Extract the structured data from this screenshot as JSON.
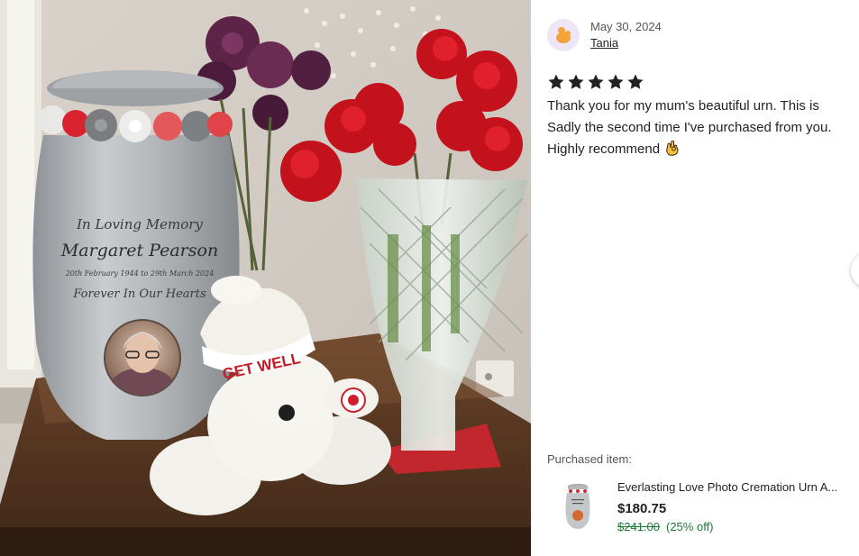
{
  "photo": {
    "urn": {
      "line1": "In Loving Memory",
      "line2": "Margaret Pearson",
      "line3": "20th February 1944 to 29th March 2024",
      "line4": "Forever In Our Hearts"
    },
    "teddy_hat_text": "GET WELL"
  },
  "review": {
    "date": "May 30, 2024",
    "reviewer": "Tania",
    "rating": 5,
    "text": "Thank you for my mum's beautiful urn. This is Sadly the second time I've purchased from you. Highly recommend",
    "emoji_icon": "ok-hand-icon"
  },
  "purchased": {
    "label": "Purchased item:",
    "title": "Everlasting Love Photo Cremation Urn A...",
    "price": "$180.75",
    "original_price": "$241.00",
    "discount": "(25% off)"
  },
  "colors": {
    "star": "#222222",
    "sale_green": "#1f7a3a",
    "avatar_bg": "#eee6f6",
    "avatar_icon": "#f2a33a"
  }
}
